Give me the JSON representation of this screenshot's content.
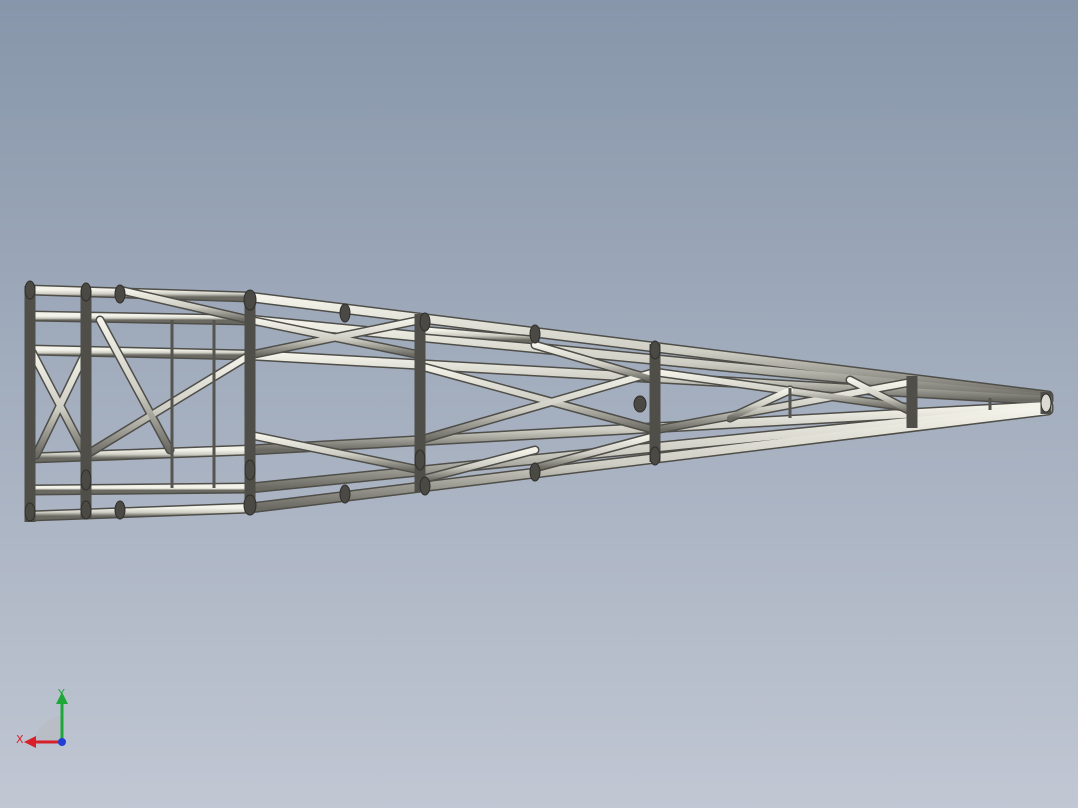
{
  "viewport": {
    "background_top": "#8796aa",
    "background_bottom": "#c1c7d3"
  },
  "model": {
    "tube_color": "#d7d6cc",
    "tube_shade": "#5e5d57",
    "tube_highlight": "#f4f3ea"
  },
  "triad": {
    "x_label": "X",
    "y_label": "Y",
    "x_color": "#d8202a",
    "y_color": "#1ea83a",
    "z_color": "#1f3fd6"
  }
}
